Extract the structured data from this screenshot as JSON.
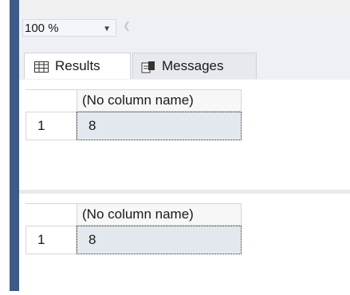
{
  "zoom": {
    "value": "100 %"
  },
  "tabs": [
    {
      "label": "Results",
      "icon": "grid-icon",
      "active": true
    },
    {
      "label": "Messages",
      "icon": "messages-icon",
      "active": false
    }
  ],
  "result_sets": [
    {
      "header": "(No column name)",
      "rows": [
        {
          "row_number": "1",
          "value": "8"
        }
      ]
    },
    {
      "header": "(No column name)",
      "rows": [
        {
          "row_number": "1",
          "value": "8"
        }
      ]
    }
  ],
  "colors": {
    "left_bar": "#3e5a86",
    "selected_cell": "#e3e7ee"
  }
}
